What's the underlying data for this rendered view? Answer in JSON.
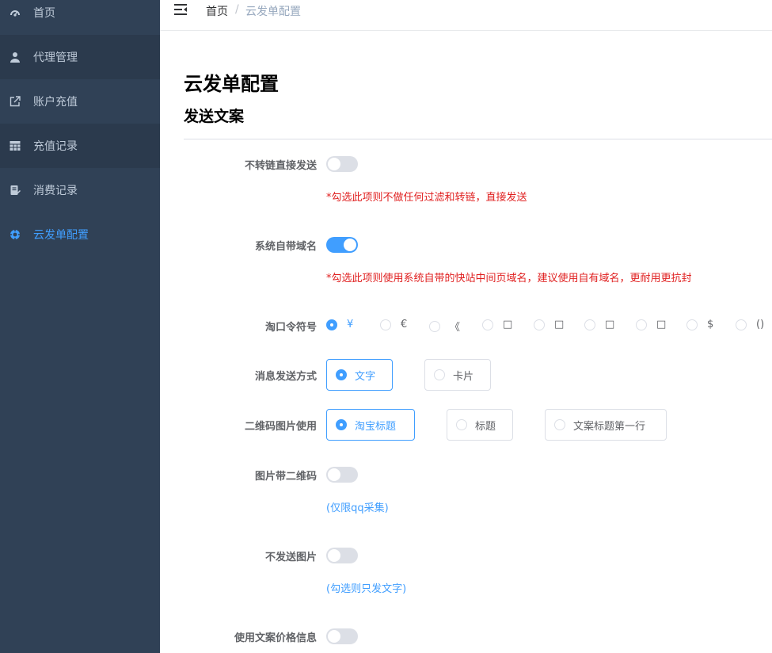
{
  "sidebar": {
    "items": [
      {
        "label": "首页",
        "icon": "dashboard-icon"
      },
      {
        "label": "代理管理",
        "icon": "user-icon"
      },
      {
        "label": "账户充值",
        "icon": "external-link-icon"
      },
      {
        "label": "充值记录",
        "icon": "table-icon"
      },
      {
        "label": "消费记录",
        "icon": "document-icon"
      },
      {
        "label": "云发单配置",
        "icon": "settings-icon"
      }
    ],
    "active_color": "#409eff",
    "background": "#304156"
  },
  "header": {
    "breadcrumb_home": "首页",
    "breadcrumb_separator": "/",
    "breadcrumb_current": "云发单配置"
  },
  "page": {
    "title": "云发单配置",
    "section_title": "发送文案"
  },
  "form": {
    "no_convert": {
      "label": "不转链直接发送",
      "enabled": false,
      "hint": "*勾选此项则不做任何过滤和转链，直接发送"
    },
    "system_domain": {
      "label": "系统自带域名",
      "enabled": true,
      "hint": "*勾选此项则使用系统自带的快站中间页域名，建议使用自有域名，更耐用更抗封"
    },
    "tao_symbol": {
      "label": "淘口令符号",
      "options": [
        "¥",
        "€",
        "《",
        "□",
        "□",
        "□",
        "□",
        "$",
        "()"
      ],
      "selected": "¥"
    },
    "send_mode": {
      "label": "消息发送方式",
      "options": [
        "文字",
        "卡片"
      ],
      "selected": "文字"
    },
    "qr_image": {
      "label": "二维码图片使用",
      "options": [
        "淘宝标题",
        "标题",
        "文案标题第一行"
      ],
      "selected": "淘宝标题"
    },
    "image_qr": {
      "label": "图片带二维码",
      "enabled": false,
      "hint": "(仅限qq采集)"
    },
    "no_image": {
      "label": "不发送图片",
      "enabled": false,
      "hint": "(勾选则只发文字)"
    },
    "price_info": {
      "label": "使用文案价格信息",
      "enabled": false
    }
  }
}
